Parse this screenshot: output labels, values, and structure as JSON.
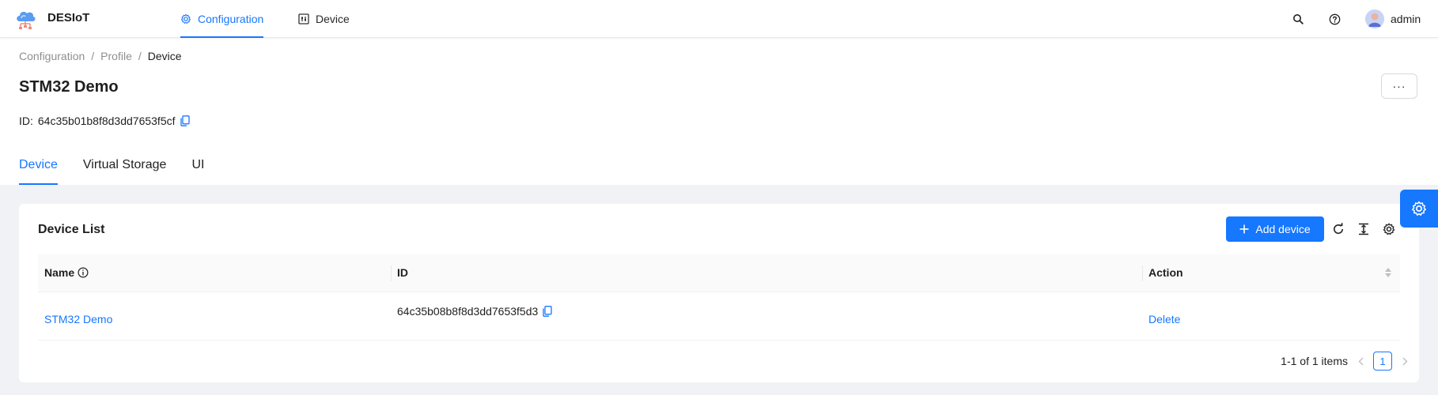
{
  "app": {
    "title": "DESIoT"
  },
  "nav": {
    "tabs": [
      {
        "label": "Configuration",
        "active": true
      },
      {
        "label": "Device",
        "active": false
      }
    ],
    "user": "admin"
  },
  "breadcrumb": {
    "items": [
      "Configuration",
      "Profile",
      "Device"
    ],
    "separator": "/"
  },
  "header": {
    "title": "STM32 Demo",
    "id_label": "ID:",
    "id_value": "64c35b01b8f8d3dd7653f5cf",
    "more_label": "···"
  },
  "subtabs": [
    {
      "label": "Device",
      "active": true
    },
    {
      "label": "Virtual Storage",
      "active": false
    },
    {
      "label": "UI",
      "active": false
    }
  ],
  "device_list": {
    "title": "Device List",
    "add_button": "Add device",
    "columns": [
      "Name",
      "ID",
      "Action"
    ],
    "rows": [
      {
        "name": "STM32 Demo",
        "id": "64c35b08b8f8d3dd7653f5d3",
        "action": "Delete"
      }
    ],
    "pagination": {
      "summary": "1-1 of 1 items",
      "current_page": "1"
    }
  },
  "colors": {
    "primary": "#1677ff",
    "content_bg": "#f0f2f5"
  },
  "icons": [
    "cloud-logo-icon",
    "gear-icon",
    "device-icon",
    "search-icon",
    "help-icon",
    "user-avatar-icon",
    "copy-icon",
    "plus-icon",
    "reload-icon",
    "column-height-icon",
    "settings-icon",
    "info-icon",
    "sort-icon",
    "chevron-left-icon",
    "chevron-right-icon"
  ]
}
